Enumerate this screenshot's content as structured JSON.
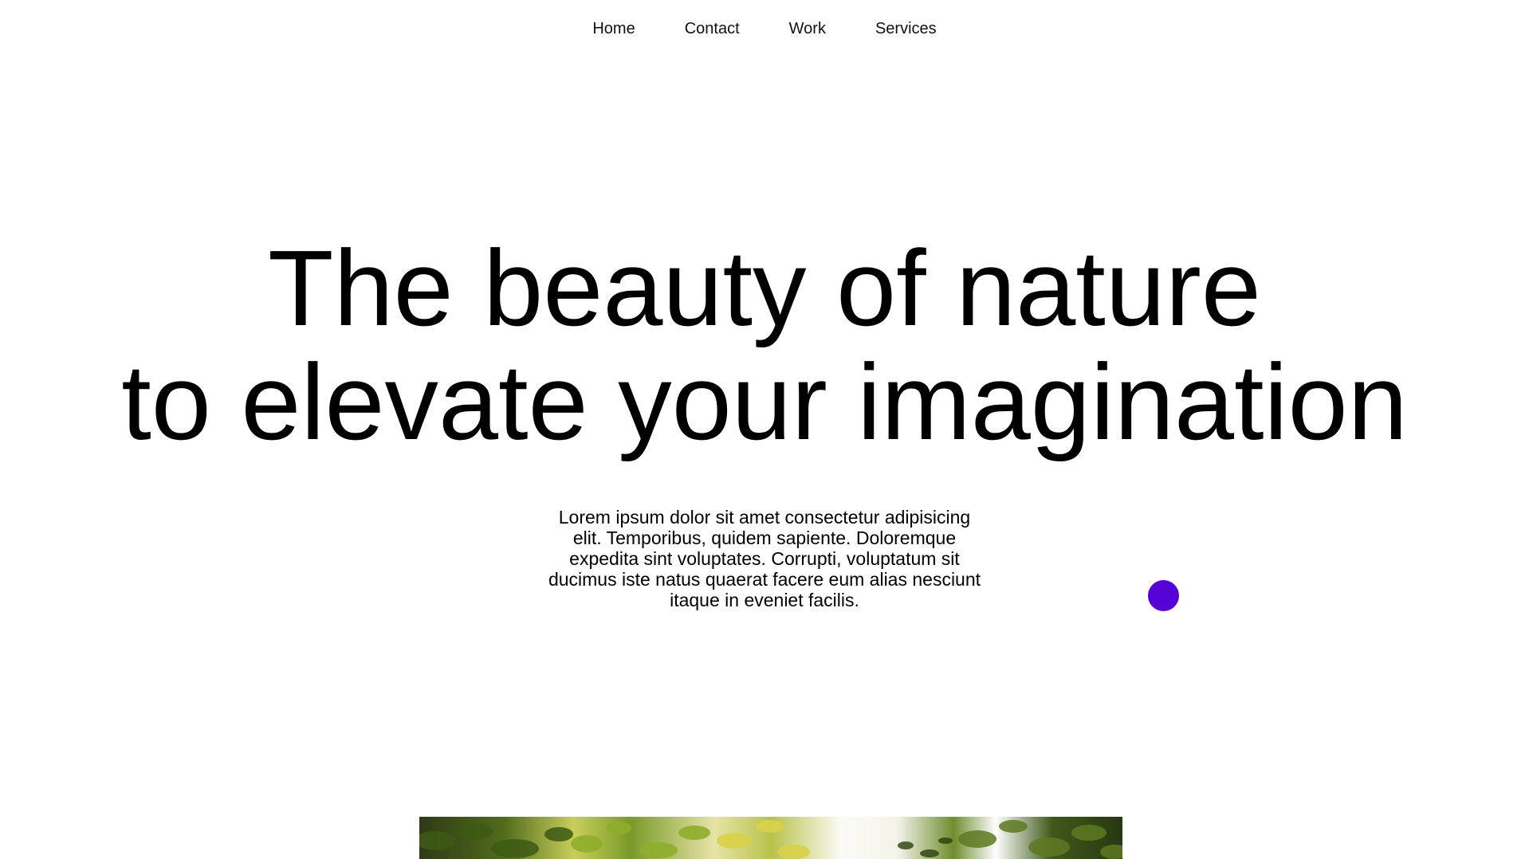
{
  "nav": {
    "items": [
      {
        "label": "Home"
      },
      {
        "label": "Contact"
      },
      {
        "label": "Work"
      },
      {
        "label": "Services"
      }
    ]
  },
  "hero": {
    "title_line1": "The beauty of nature",
    "title_line2": "to elevate your imagination",
    "body": "Lorem ipsum dolor sit amet consectetur adipisicing elit. Temporibus, quidem sapiente. Doloremque expedita sint voluptates. Corrupti, voluptatum sit ducimus iste natus quaerat facere eum alias nesciunt itaque in eveniet facilis."
  },
  "colors": {
    "cursor_dot": "#5500d4",
    "background": "#ffffff",
    "text": "#000000"
  }
}
